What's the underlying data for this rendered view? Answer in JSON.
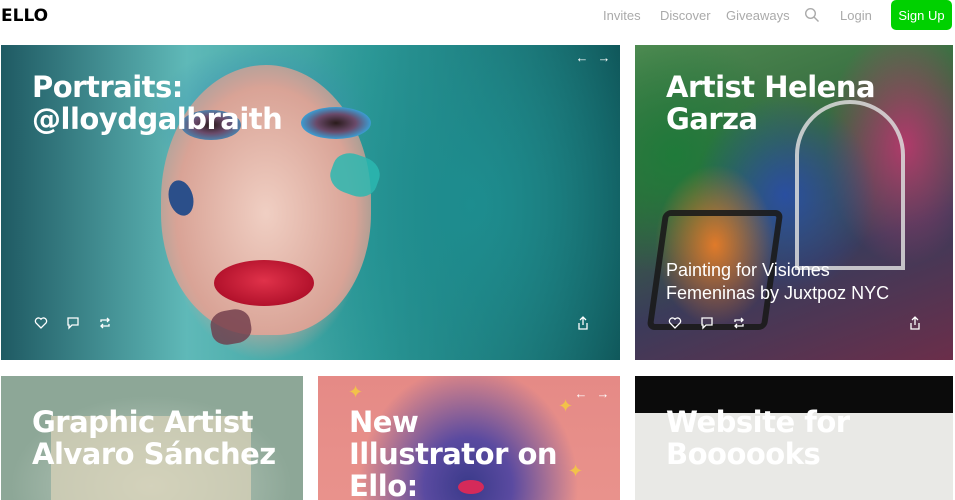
{
  "header": {
    "logo": "ELLO",
    "nav": {
      "invites": "Invites",
      "discover": "Discover",
      "giveaways": "Giveaways",
      "search_icon": "search-icon",
      "login": "Login"
    },
    "signup_label": "Sign Up",
    "colors": {
      "signup_bg": "#00d100",
      "nav_text": "#aaaaaa"
    }
  },
  "cards": [
    {
      "title_line1": "Portraits:",
      "title_line2": "@lloydgalbraith",
      "has_arrows": true,
      "actions": [
        "heart-icon",
        "comment-icon",
        "repost-icon"
      ],
      "share_icon": "share-icon"
    },
    {
      "title_line1": "Artist Helena",
      "title_line2": "Garza",
      "subtitle_line1": "Painting for Visiones",
      "subtitle_line2": "Femeninas by Juxtpoz NYC",
      "actions": [
        "heart-icon",
        "comment-icon",
        "repost-icon"
      ],
      "share_icon": "share-icon"
    },
    {
      "title_line1": "Graphic Artist",
      "title_line2": "Alvaro Sánchez"
    },
    {
      "title_line1": "New",
      "title_line2": "Illustrator on",
      "title_line3": "Ello:",
      "has_arrows": true
    },
    {
      "title_line1": "Website for",
      "title_line2": "Boooooks"
    }
  ],
  "arrows": {
    "prev": "←",
    "next": "→"
  }
}
